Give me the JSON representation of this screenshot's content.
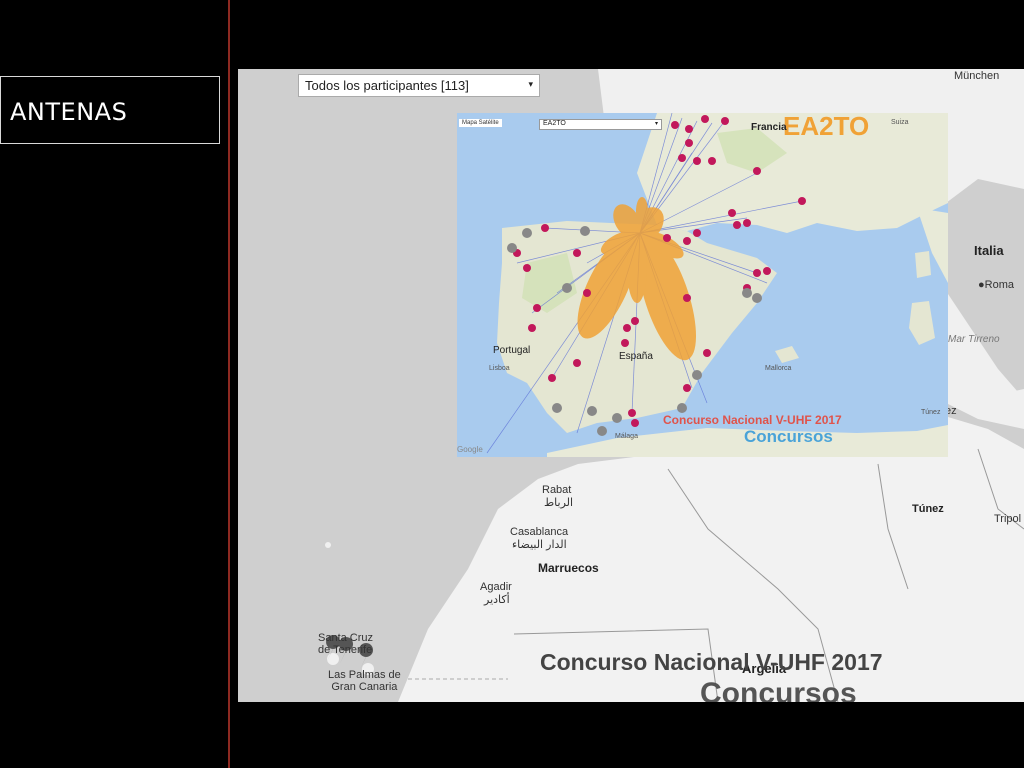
{
  "slide": {
    "title": "ANTENAS"
  },
  "outer_map": {
    "participant_selector": {
      "value": "Todos los participantes [113]",
      "caret": "▾"
    },
    "labels": {
      "munich": "München",
      "italia": "Italia",
      "roma": "●Roma",
      "mar_tirreno": "Mar Tirreno",
      "tunez_top": "Túnez",
      "tunez": "Túnez",
      "tripoli": "Tripol",
      "rabat": "Rabat",
      "rabat_ar": "الرباط",
      "casablanca": "Casablanca",
      "casablanca_ar": "الدار البيضاء",
      "marruecos": "Marruecos",
      "agadir": "Agadir",
      "agadir_ar": "أكادير",
      "santa_cruz": "Santa Cruz\nde Tenerife",
      "las_palmas": "Las Palmas de\nGran Canaria",
      "argelia": "Argelia",
      "big_contest": "Concurso Nacional V-UHF 2017",
      "big_concursos": "Concursos"
    }
  },
  "inner_map": {
    "tabs": "Mapa  Satélite",
    "selector": {
      "value": "EA2TO",
      "caret": "▾"
    },
    "station": "EA2TO",
    "labels": {
      "francia": "Francia",
      "portugal": "Portugal",
      "espana": "España",
      "lisboa": "Lisboa",
      "suiza": "Suiza",
      "malaga": "Málaga",
      "mallorca": "Mallorca",
      "tunez": "Túnez",
      "google": "Google"
    },
    "contest_label": "Concurso Nacional V-UHF 2017",
    "concursos_label": "Concursos"
  },
  "colors": {
    "accent": "#f0a236",
    "red_line": "#8e2a22",
    "marker": "#c2185b",
    "contest": "#e0534a",
    "concursos": "#4aa3d8"
  }
}
